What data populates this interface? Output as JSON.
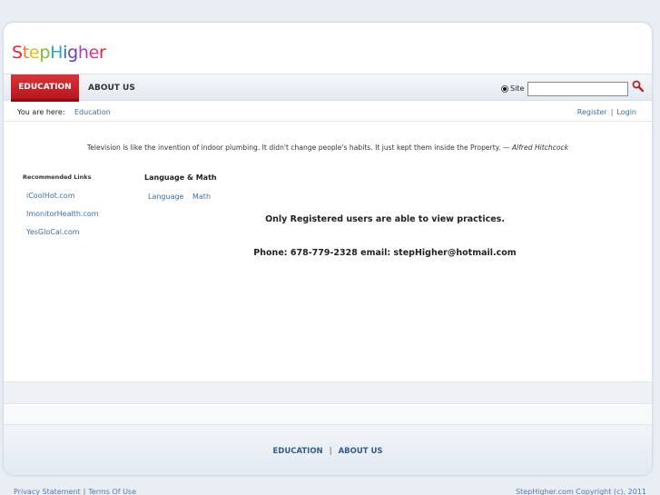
{
  "logo": {
    "text": "StepHigher",
    "letters": [
      "S",
      "t",
      "e",
      "p",
      "H",
      "i",
      "g",
      "h",
      "e",
      "r"
    ],
    "colors": [
      "#e8262e",
      "#f0761f",
      "#e8b817",
      "#7cbf2a",
      "#2aa3d8",
      "#1b6fc2",
      "#6c3cc0",
      "#b13cb8",
      "#e3338a",
      "#e8262e"
    ]
  },
  "nav": {
    "items": [
      "EDUCATION",
      "ABOUT US"
    ],
    "active_color": "#c7222a",
    "search": {
      "radio_label": "Site",
      "value": ""
    }
  },
  "breadcrumb": {
    "label": "You are here:",
    "current": "Education",
    "register": "Register",
    "separator": "|",
    "login": "Login"
  },
  "quote": {
    "text": "Television is like the invention of indoor plumbing. It didn't change people's habits. It just kept them inside the Property. —",
    "author": "Alfred Hitchcock"
  },
  "recommended": {
    "title": "Recommended Links",
    "links": [
      "iCoolHot.com",
      "ImonitorHealth.com",
      "YesGloCal.com"
    ]
  },
  "language_math": {
    "title": "Language & Math",
    "links": [
      "Language",
      "Math"
    ]
  },
  "main": {
    "message": "Only Registered users are able to view practices.",
    "contact": "Phone: 678-779-2328 email: stepHigher@hotmail.com"
  },
  "footer_nav": {
    "items": [
      "EDUCATION",
      "ABOUT US"
    ],
    "separator": "|"
  },
  "bottom": {
    "privacy": "Privacy Statement",
    "separator": "|",
    "terms": "Terms Of Use",
    "copyright": "StepHigher.com Copyright (c), 2011"
  }
}
